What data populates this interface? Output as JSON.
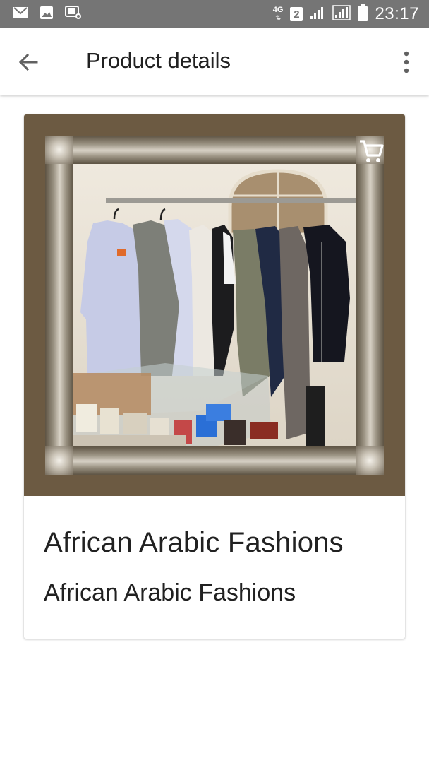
{
  "status_bar": {
    "icons": [
      "mail-icon",
      "image-icon",
      "cast-icon"
    ],
    "network_type": "4G",
    "sim_slot": "2",
    "time": "23:17",
    "background_color": "#757575"
  },
  "app_bar": {
    "title": "Product details",
    "back_icon": "arrow-back-icon",
    "menu_icon": "more-vert-icon"
  },
  "product": {
    "image_description_icon": "shopping-cart-icon",
    "frame_color": "#6c5a42",
    "title": "African Arabic Fashions",
    "subtitle": "African Arabic Fashions"
  }
}
